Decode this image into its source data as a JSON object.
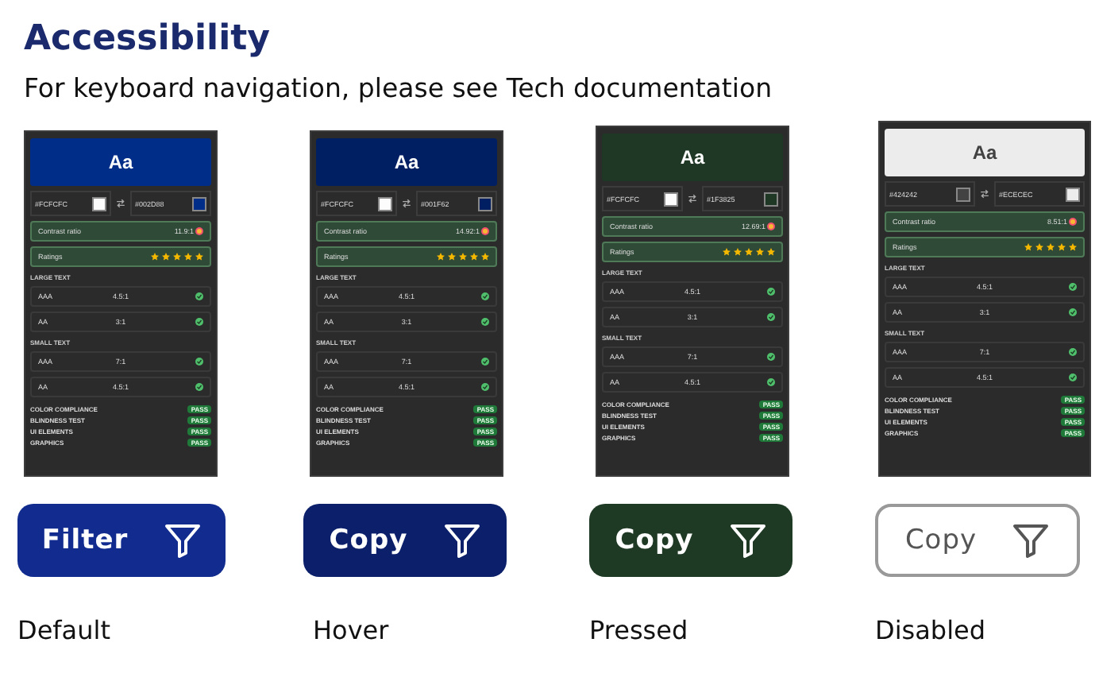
{
  "title": "Accessibility",
  "subtitle": "For keyboard navigation, please see Tech documentation",
  "variants": [
    {
      "kind": "default",
      "caption": "Default",
      "button": {
        "label": "Filter"
      },
      "panel": {
        "preview": "Aa",
        "swatches": [
          {
            "hex": "#FCFCFC",
            "color": "#fcfcfc"
          },
          {
            "hex": "#002D88",
            "color": "#002d88"
          }
        ],
        "contrast_label": "Contrast ratio",
        "contrast": "11.9:1",
        "ratings_label": "Ratings",
        "stars": 5,
        "groups": [
          {
            "heading": "LARGE TEXT",
            "rows": [
              {
                "level": "AAA",
                "ratio": "4.5:1",
                "passed": true
              },
              {
                "level": "AA",
                "ratio": "3:1",
                "passed": true
              }
            ]
          },
          {
            "heading": "SMALL TEXT",
            "rows": [
              {
                "level": "AAA",
                "ratio": "7:1",
                "passed": true
              },
              {
                "level": "AA",
                "ratio": "4.5:1",
                "passed": true
              }
            ]
          }
        ],
        "checks": [
          {
            "label": "COLOR COMPLIANCE",
            "badge": "PASS"
          },
          {
            "label": "BLINDNESS TEST",
            "badge": "PASS"
          },
          {
            "label": "UI ELEMENTS",
            "badge": "PASS"
          },
          {
            "label": "GRAPHICS",
            "badge": "PASS"
          }
        ]
      }
    },
    {
      "kind": "hover",
      "caption": "Hover",
      "button": {
        "label": "Copy"
      },
      "panel": {
        "preview": "Aa",
        "swatches": [
          {
            "hex": "#FCFCFC",
            "color": "#fcfcfc"
          },
          {
            "hex": "#001F62",
            "color": "#001f62"
          }
        ],
        "contrast_label": "Contrast ratio",
        "contrast": "14.92:1",
        "ratings_label": "Ratings",
        "stars": 5,
        "groups": [
          {
            "heading": "LARGE TEXT",
            "rows": [
              {
                "level": "AAA",
                "ratio": "4.5:1",
                "passed": true
              },
              {
                "level": "AA",
                "ratio": "3:1",
                "passed": true
              }
            ]
          },
          {
            "heading": "SMALL TEXT",
            "rows": [
              {
                "level": "AAA",
                "ratio": "7:1",
                "passed": true
              },
              {
                "level": "AA",
                "ratio": "4.5:1",
                "passed": true
              }
            ]
          }
        ],
        "checks": [
          {
            "label": "COLOR COMPLIANCE",
            "badge": "PASS"
          },
          {
            "label": "BLINDNESS TEST",
            "badge": "PASS"
          },
          {
            "label": "UI ELEMENTS",
            "badge": "PASS"
          },
          {
            "label": "GRAPHICS",
            "badge": "PASS"
          }
        ]
      }
    },
    {
      "kind": "pressed",
      "caption": "Pressed",
      "button": {
        "label": "Copy"
      },
      "panel": {
        "preview": "Aa",
        "swatches": [
          {
            "hex": "#FCFCFC",
            "color": "#fcfcfc"
          },
          {
            "hex": "#1F3825",
            "color": "#1f3825"
          }
        ],
        "contrast_label": "Contrast ratio",
        "contrast": "12.69:1",
        "ratings_label": "Ratings",
        "stars": 5,
        "groups": [
          {
            "heading": "LARGE TEXT",
            "rows": [
              {
                "level": "AAA",
                "ratio": "4.5:1",
                "passed": true
              },
              {
                "level": "AA",
                "ratio": "3:1",
                "passed": true
              }
            ]
          },
          {
            "heading": "SMALL TEXT",
            "rows": [
              {
                "level": "AAA",
                "ratio": "7:1",
                "passed": true
              },
              {
                "level": "AA",
                "ratio": "4.5:1",
                "passed": true
              }
            ]
          }
        ],
        "checks": [
          {
            "label": "COLOR COMPLIANCE",
            "badge": "PASS"
          },
          {
            "label": "BLINDNESS TEST",
            "badge": "PASS"
          },
          {
            "label": "UI ELEMENTS",
            "badge": "PASS"
          },
          {
            "label": "GRAPHICS",
            "badge": "PASS"
          }
        ]
      }
    },
    {
      "kind": "disabled",
      "caption": "Disabled",
      "button": {
        "label": "Copy"
      },
      "panel": {
        "preview": "Aa",
        "swatches": [
          {
            "hex": "#424242",
            "color": "#424242"
          },
          {
            "hex": "#ECECEC",
            "color": "#ececec"
          }
        ],
        "contrast_label": "Contrast ratio",
        "contrast": "8.51:1",
        "ratings_label": "Ratings",
        "stars": 5,
        "groups": [
          {
            "heading": "LARGE TEXT",
            "rows": [
              {
                "level": "AAA",
                "ratio": "4.5:1",
                "passed": true
              },
              {
                "level": "AA",
                "ratio": "3:1",
                "passed": true
              }
            ]
          },
          {
            "heading": "SMALL TEXT",
            "rows": [
              {
                "level": "AAA",
                "ratio": "7:1",
                "passed": true
              },
              {
                "level": "AA",
                "ratio": "4.5:1",
                "passed": true
              }
            ]
          }
        ],
        "checks": [
          {
            "label": "COLOR COMPLIANCE",
            "badge": "PASS"
          },
          {
            "label": "BLINDNESS TEST",
            "badge": "PASS"
          },
          {
            "label": "UI ELEMENTS",
            "badge": "PASS"
          },
          {
            "label": "GRAPHICS",
            "badge": "PASS"
          }
        ]
      }
    }
  ]
}
